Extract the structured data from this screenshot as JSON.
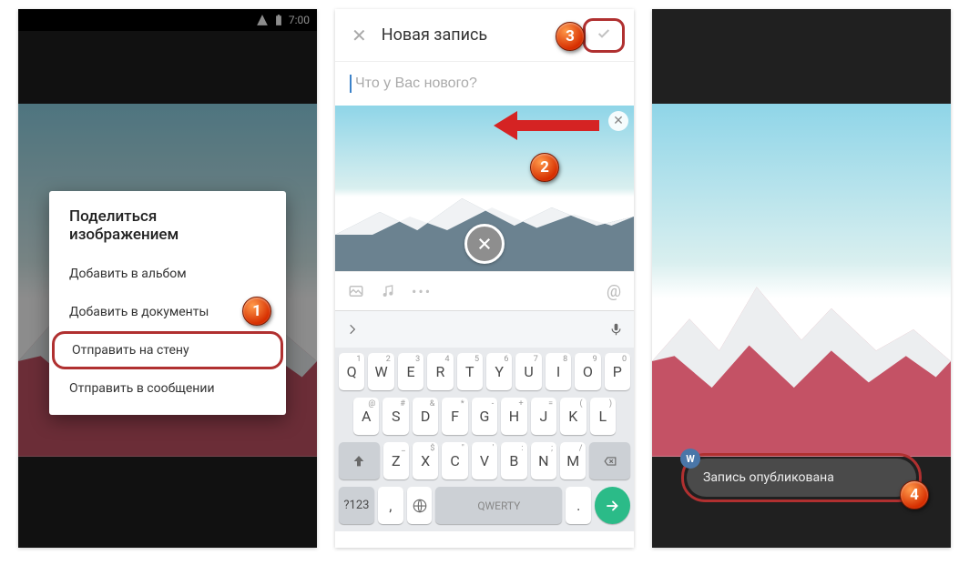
{
  "status": {
    "time": "7:00"
  },
  "s1": {
    "title": "Поделиться изображением",
    "items": [
      "Добавить в альбом",
      "Добавить в документы",
      "Отправить на стену",
      "Отправить в сообщении"
    ]
  },
  "s2": {
    "title": "Новая запись",
    "placeholder": "Что у Вас нового?",
    "kbHint": "QWERTY",
    "row1": [
      [
        "Q",
        "1"
      ],
      [
        "W",
        "2"
      ],
      [
        "E",
        "3"
      ],
      [
        "R",
        "4"
      ],
      [
        "T",
        "5"
      ],
      [
        "Y",
        "6"
      ],
      [
        "U",
        "7"
      ],
      [
        "I",
        "8"
      ],
      [
        "O",
        "9"
      ],
      [
        "P",
        "0"
      ]
    ],
    "row2": [
      [
        "A",
        "@"
      ],
      [
        "S",
        "#"
      ],
      [
        "D",
        "&"
      ],
      [
        "F",
        "*"
      ],
      [
        "G",
        "-"
      ],
      [
        "H",
        "+"
      ],
      [
        "J",
        "="
      ],
      [
        "K",
        "("
      ],
      [
        "L",
        ")"
      ]
    ],
    "row3": [
      [
        "Z",
        "_"
      ],
      [
        "X",
        "$"
      ],
      [
        "C",
        "\""
      ],
      [
        "V",
        "'"
      ],
      [
        "B",
        ":"
      ],
      [
        "N",
        ";"
      ],
      [
        "M",
        "/"
      ]
    ],
    "numKey": "?123"
  },
  "s3": {
    "toast": "Запись опубликована"
  },
  "badges": {
    "b1": "1",
    "b2": "2",
    "b3": "3",
    "b4": "4"
  }
}
